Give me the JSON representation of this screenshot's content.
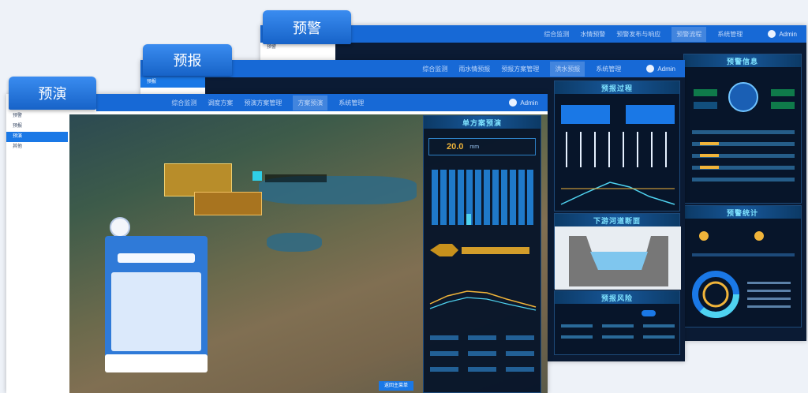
{
  "tabs": {
    "warning": "预警",
    "forecast": "预报",
    "rehearsal": "预演"
  },
  "user": "Admin",
  "warning_window": {
    "nav": [
      "综合监测",
      "水情预警",
      "预警发布与响应",
      "预警流程",
      "系统管理"
    ],
    "active_index": 3,
    "panel_titles": [
      "预警信息",
      "预警统计"
    ]
  },
  "forecast_window": {
    "nav": [
      "综合监测",
      "雨水情预报",
      "预报方案管理",
      "洪水预报",
      "系统管理"
    ],
    "active_index": 3,
    "panel_titles": [
      "预报过程",
      "下游河道断面",
      "预报风险"
    ]
  },
  "rehearsal_window": {
    "nav": [
      "综合监测",
      "调度方案",
      "预演方案管理",
      "方案预演",
      "系统管理"
    ],
    "active_index": 3,
    "panel_title": "单方案预演",
    "value": "20.0",
    "unit": "mm",
    "bottom_button": "返回主菜单"
  },
  "sidebar_items": [
    "预警",
    "预报",
    "预演",
    "其他"
  ],
  "chart_colors": {
    "bars": "#1f79c9",
    "line1": "#f0b43a",
    "line2": "#4fd3f0",
    "accent": "#2f7ad8"
  }
}
